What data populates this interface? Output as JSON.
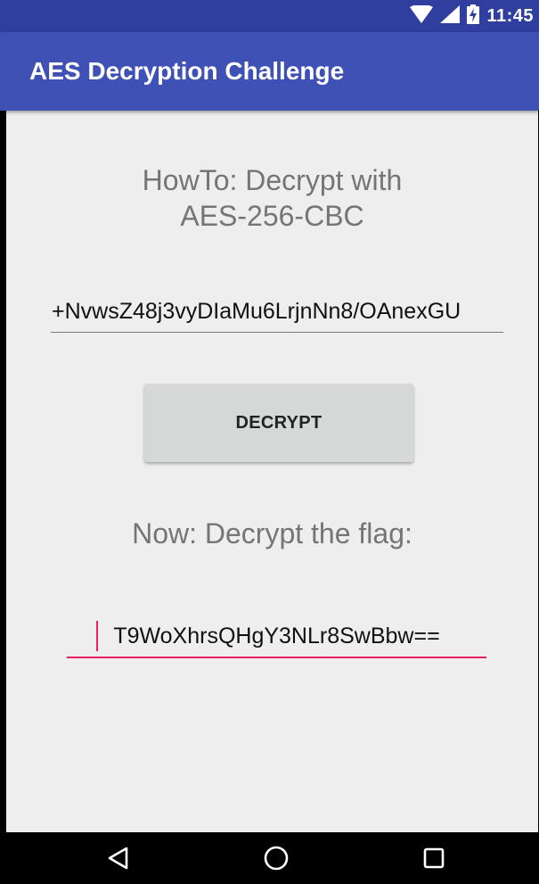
{
  "status_bar": {
    "time": "11:45",
    "icons": [
      "wifi-icon",
      "cell-signal-icon",
      "battery-charging-icon"
    ]
  },
  "app_bar": {
    "title": "AES Decryption Challenge",
    "color": "#3f51b5"
  },
  "main": {
    "howto_line1": "HowTo: Decrypt with",
    "howto_line2": "AES-256-CBC",
    "ciphertext_value": "+NvwsZ48j3vyDIaMu6LrjnNn8/OAnexGU",
    "decrypt_label": "DECRYPT",
    "now_label": "Now: Decrypt the flag:",
    "flag_value": "T9WoXhrsQHgY3NLr8SwBbw=="
  },
  "nav_bar": {
    "icons": [
      "back-icon",
      "home-icon",
      "recents-icon"
    ]
  },
  "colors": {
    "status_bar": "#303f9f",
    "accent": "#e91e63",
    "background": "#eeeeee",
    "button": "#d6d7d7"
  }
}
